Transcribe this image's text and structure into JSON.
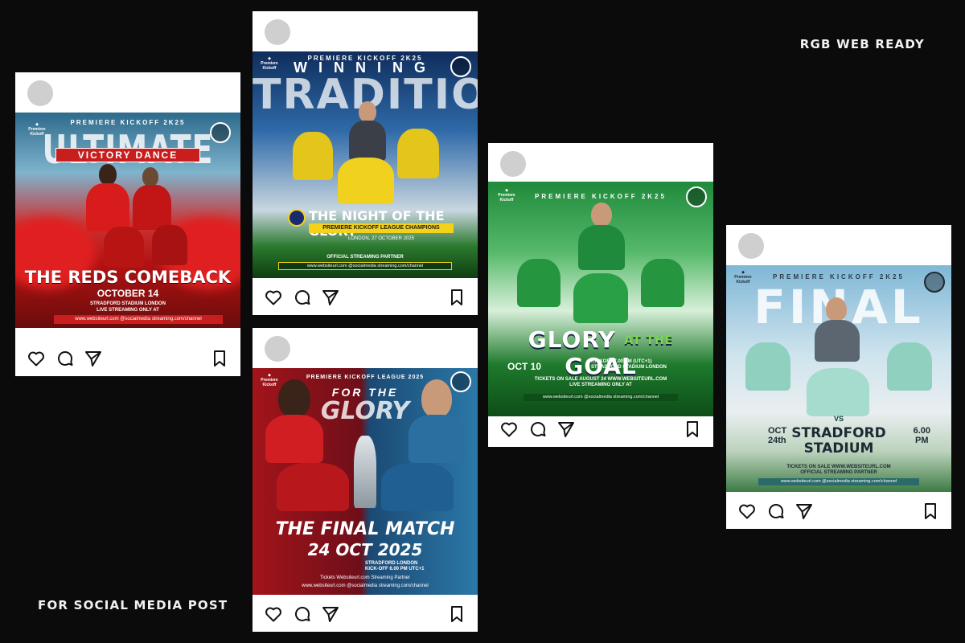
{
  "labels": {
    "top_right": "RGB WEB READY",
    "bottom_left": "FOR SOCIAL MEDIA POST"
  },
  "icons": [
    "heart-icon",
    "comment-icon",
    "send-icon",
    "bookmark-icon"
  ],
  "colors": {
    "background": "#0b0b0c",
    "post_bg": "#ffffff",
    "avatar": "#cfcfcf",
    "red_theme": "#c81e1e",
    "yellow_theme": "#f4d21a",
    "green_theme": "#1f8a3b"
  },
  "posts": [
    {
      "league": "PREMIERE KICKOFF 2K25",
      "title": "ULTIMATE",
      "banner": "VICTORY DANCE",
      "headline": "THE REDS COMEBACK",
      "date": "OCTOBER 14",
      "venue_line1": "STRADFORD STADIUM LONDON",
      "venue_line2": "LIVE STREAMING ONLY AT",
      "bar": "www.websiteurl.com   @socialmedia   streaming.com/channel"
    },
    {
      "league": "PREMIERE KICKOFF 2K25",
      "title_top": "WINNING",
      "title_big": "TRADITION",
      "headline": "THE NIGHT OF THE GLORY",
      "champions": "PREMIERE KICKOFF LEAGUE CHAMPIONS",
      "location": "LONDON, 27 OCTOBER 2025",
      "partner": "OFFICIAL STREAMING PARTNER",
      "bar": "www.websiteurl.com   @socialmedia   streaming.com/channel"
    },
    {
      "league": "PREMIERE KICKOFF LEAGUE 2025",
      "for_the": "FOR THE",
      "glory": "GLORY",
      "headline": "THE FINAL MATCH",
      "date": "24 OCT 2025",
      "venue_line1": "STRADFORD LONDON",
      "venue_line2": "KICK-OFF 6.00 PM UTC+1",
      "bar_line1": "Tickets  Websiteurl.com   Streaming Partner",
      "bar_line2": "www.websiteurl.com   @socialmedia   streaming.com/channel"
    },
    {
      "league": "PREMIERE KICKOFF 2K25",
      "glory": "GLORY",
      "at_the": "AT THE",
      "goal": "GOAL",
      "date": "OCT 10",
      "kickoff_line1": "KICKOFF 7.00 PM (UTC+1)",
      "kickoff_line2": "STRADFORD STADIUM LONDON",
      "tickets": "TICKETS ON SALE AUGUST 24 WWW.WEBSITEURL.COM",
      "streaming": "LIVE STREAMING ONLY AT",
      "bar": "www.websiteurl.com   @socialmedia   streaming.com/channel"
    },
    {
      "league": "PREMIERE KICKOFF 2K25",
      "title": "FINAL",
      "vs": "VS",
      "date_line1": "OCT",
      "date_line2": "24th",
      "stadium_line1": "STRADFORD",
      "stadium_line2": "STADIUM",
      "time_line1": "6.00",
      "time_line2": "PM",
      "tickets": "TICKETS ON SALE WWW.WEBSITEURL.COM",
      "partner": "OFFICIAL STREAMING PARTNER",
      "bar": "www.websiteurl.com   @socialmedia   streaming.com/channel"
    }
  ]
}
